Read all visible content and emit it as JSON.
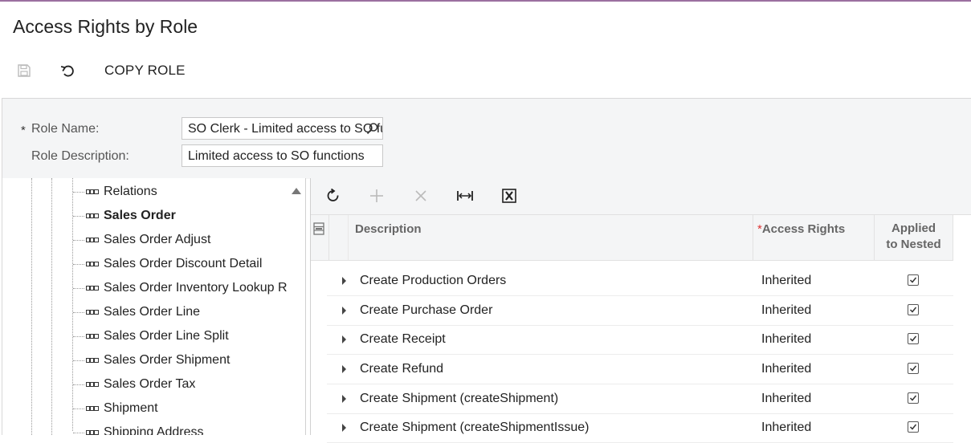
{
  "page": {
    "title": "Access Rights by Role"
  },
  "toolbar": {
    "save_icon": "save-icon",
    "undo_icon": "undo-icon",
    "copy_role_label": "COPY ROLE"
  },
  "form": {
    "role_name_required": "*",
    "role_name_label": "Role Name:",
    "role_name_value": "SO Clerk - Limited access to SO functions",
    "role_description_label": "Role Description:",
    "role_description_value": "Limited access to SO functions"
  },
  "tree": {
    "items": [
      {
        "label": "Relations",
        "bold": false
      },
      {
        "label": "Sales Order",
        "bold": true
      },
      {
        "label": "Sales Order Adjust",
        "bold": false
      },
      {
        "label": "Sales Order Discount Detail",
        "bold": false
      },
      {
        "label": "Sales Order Inventory Lookup R",
        "bold": false
      },
      {
        "label": "Sales Order Line",
        "bold": false
      },
      {
        "label": "Sales Order Line Split",
        "bold": false
      },
      {
        "label": "Sales Order Shipment",
        "bold": false
      },
      {
        "label": "Sales Order Tax",
        "bold": false
      },
      {
        "label": "Shipment",
        "bold": false
      },
      {
        "label": "Shipping Address",
        "bold": false
      }
    ]
  },
  "grid": {
    "toolbar_icons": [
      "refresh-icon",
      "add-icon",
      "delete-icon",
      "fit-columns-icon",
      "export-excel-icon"
    ],
    "columns": {
      "description": "Description",
      "access_rights_required": "*",
      "access_rights": "Access Rights",
      "applied_line1": "Applied",
      "applied_line2": "to Nested"
    },
    "rows": [
      {
        "description": "Create Production Orders",
        "access_rights": "Inherited",
        "applied_to_nested": true
      },
      {
        "description": "Create Purchase Order",
        "access_rights": "Inherited",
        "applied_to_nested": true
      },
      {
        "description": "Create Receipt",
        "access_rights": "Inherited",
        "applied_to_nested": true
      },
      {
        "description": "Create Refund",
        "access_rights": "Inherited",
        "applied_to_nested": true
      },
      {
        "description": "Create Shipment (createShipment)",
        "access_rights": "Inherited",
        "applied_to_nested": true
      },
      {
        "description": "Create Shipment (createShipmentIssue)",
        "access_rights": "Inherited",
        "applied_to_nested": true
      }
    ]
  }
}
